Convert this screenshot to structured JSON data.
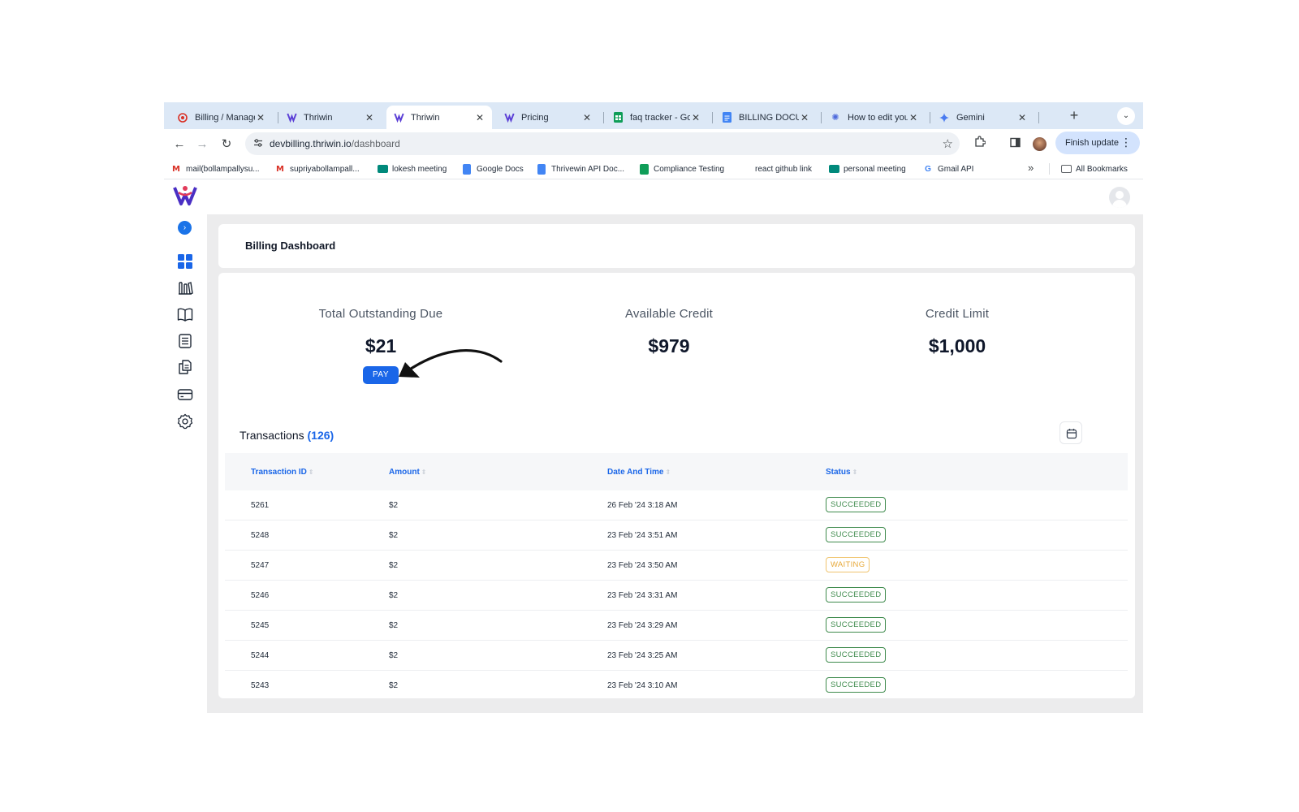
{
  "browser": {
    "tabs": [
      {
        "label": "Billing / Manage",
        "icon": "billing-tab-icon",
        "active": false
      },
      {
        "label": "Thriwin",
        "icon": "thriwin-logo-icon",
        "active": false
      },
      {
        "label": "Thriwin",
        "icon": "thriwin-logo-icon",
        "active": true
      },
      {
        "label": "Pricing",
        "icon": "thriwin-logo-icon",
        "active": false
      },
      {
        "label": "faq tracker - Go",
        "icon": "sheets-icon",
        "active": false
      },
      {
        "label": "BILLING DOCUM",
        "icon": "docs-icon",
        "active": false
      },
      {
        "label": "How to edit your",
        "icon": "gear-icon",
        "active": false
      },
      {
        "label": "Gemini",
        "icon": "gemini-icon",
        "active": false
      }
    ],
    "url_host": "devbilling.thriwin.io",
    "url_path": "/dashboard",
    "finish_update": "Finish update",
    "bookmarks": [
      {
        "label": "mail(bollampallysu...",
        "icon": "gmail-icon"
      },
      {
        "label": "supriyabollampall...",
        "icon": "gmail-icon"
      },
      {
        "label": "lokesh meeting",
        "icon": "meet-icon"
      },
      {
        "label": "Google Docs",
        "icon": "docs-icon"
      },
      {
        "label": "Thrivewin API Doc...",
        "icon": "docs-icon"
      },
      {
        "label": "Compliance Testing",
        "icon": "sheets-icon"
      },
      {
        "label": "react github link",
        "icon": ""
      },
      {
        "label": "personal meeting",
        "icon": "meet-icon"
      },
      {
        "label": "Gmail API",
        "icon": "google-icon"
      }
    ],
    "all_bookmarks": "All Bookmarks"
  },
  "page": {
    "title": "Billing Dashboard",
    "stats": [
      {
        "label": "Total Outstanding Due",
        "value": "$21"
      },
      {
        "label": "Available Credit",
        "value": "$979"
      },
      {
        "label": "Credit Limit",
        "value": "$1,000"
      }
    ],
    "pay_label": "PAY",
    "transactions_label": "Transactions",
    "transactions_count": "(126)",
    "columns": [
      "Transaction ID",
      "Amount",
      "Date And Time",
      "Status"
    ],
    "rows": [
      {
        "id": "5261",
        "amount": "$2",
        "datetime": "26 Feb '24 3:18 AM",
        "status": "SUCCEEDED"
      },
      {
        "id": "5248",
        "amount": "$2",
        "datetime": "23 Feb '24 3:51 AM",
        "status": "SUCCEEDED"
      },
      {
        "id": "5247",
        "amount": "$2",
        "datetime": "23 Feb '24 3:50 AM",
        "status": "WAITING"
      },
      {
        "id": "5246",
        "amount": "$2",
        "datetime": "23 Feb '24 3:31 AM",
        "status": "SUCCEEDED"
      },
      {
        "id": "5245",
        "amount": "$2",
        "datetime": "23 Feb '24 3:29 AM",
        "status": "SUCCEEDED"
      },
      {
        "id": "5244",
        "amount": "$2",
        "datetime": "23 Feb '24 3:25 AM",
        "status": "SUCCEEDED"
      },
      {
        "id": "5243",
        "amount": "$2",
        "datetime": "23 Feb '24 3:10 AM",
        "status": "SUCCEEDED"
      }
    ],
    "colors": {
      "accent": "#1a66e8",
      "succeeded": "#3f8b4d",
      "waiting": "#e7a93a"
    }
  }
}
